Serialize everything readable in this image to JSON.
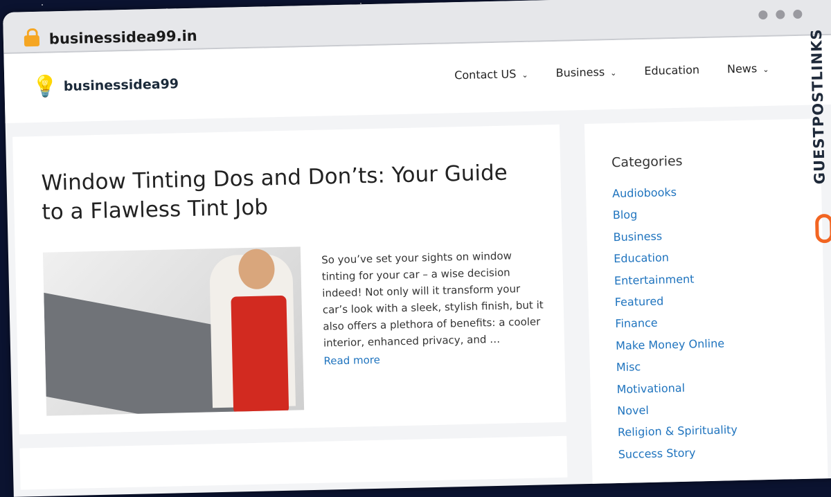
{
  "browser": {
    "url": "businessidea99.in"
  },
  "site": {
    "logo_text": "businessidea99",
    "nav": [
      {
        "label": "Contact US",
        "has_dropdown": true
      },
      {
        "label": "Business",
        "has_dropdown": true
      },
      {
        "label": "Education",
        "has_dropdown": false
      },
      {
        "label": "News",
        "has_dropdown": true
      }
    ]
  },
  "post": {
    "title": "Window Tinting Dos and Don’ts: Your Guide to a Flawless Tint Job",
    "excerpt": "So you’ve set your sights on window tinting for your car – a wise decision indeed! Not only will it transform your car’s look with a sleek, stylish finish, but it also offers a plethora of benefits: a cooler interior, enhanced privacy, and …",
    "read_more": "Read more"
  },
  "sidebar": {
    "title": "Categories",
    "categories": [
      "Audiobooks",
      "Blog",
      "Business",
      "Education",
      "Entertainment",
      "Featured",
      "Finance",
      "Make Money Online",
      "Misc",
      "Motivational",
      "Novel",
      "Religion & Spirituality",
      "Success Story"
    ]
  },
  "watermark": {
    "text": "GUESTPOSTLINKS"
  },
  "colors": {
    "link": "#1e73be",
    "lock": "#f5a623",
    "watermark_icon": "#f26522",
    "background": "#0b1330"
  }
}
